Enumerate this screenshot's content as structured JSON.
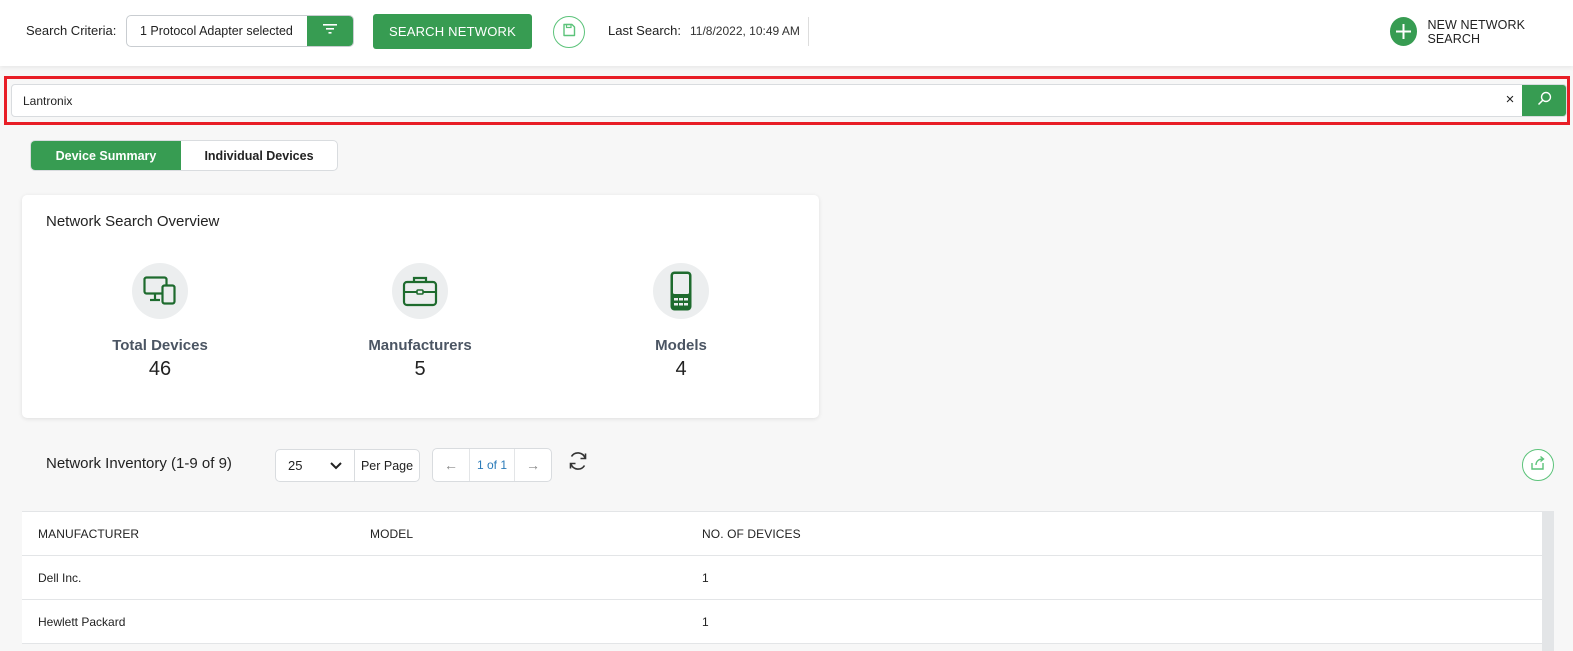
{
  "topbar": {
    "search_criteria_label": "Search Criteria:",
    "criteria_value": "1 Protocol Adapter selected",
    "search_network_label": "SEARCH NETWORK",
    "last_search_label": "Last Search:",
    "last_search_value": "11/8/2022, 10:49 AM",
    "new_search_label": "NEW NETWORK SEARCH"
  },
  "search": {
    "value": "Lantronix",
    "clear_symbol": "×"
  },
  "tabs": [
    {
      "label": "Device Summary",
      "active": true
    },
    {
      "label": "Individual Devices",
      "active": false
    }
  ],
  "overview": {
    "title": "Network Search Overview",
    "stats": [
      {
        "icon": "devices-icon",
        "label": "Total Devices",
        "value": "46"
      },
      {
        "icon": "briefcase-icon",
        "label": "Manufacturers",
        "value": "5"
      },
      {
        "icon": "handheld-device-icon",
        "label": "Models",
        "value": "4"
      }
    ]
  },
  "inventory": {
    "title": "Network Inventory (1-9 of 9)",
    "per_page_value": "25",
    "per_page_label": "Per Page",
    "page_indicator": "1 of 1",
    "prev_symbol": "←",
    "next_symbol": "→",
    "columns": [
      "MANUFACTURER",
      "MODEL",
      "NO. OF DEVICES"
    ],
    "rows": [
      {
        "manufacturer": "Dell Inc.",
        "model": "",
        "devices": "1"
      },
      {
        "manufacturer": "Hewlett Packard",
        "model": "",
        "devices": "1"
      }
    ]
  },
  "colors": {
    "accent": "#379c52",
    "accent_light": "#5cc37a",
    "highlight_outline": "#e81e26",
    "link": "#2b7bb9",
    "icon_green": "#1e6b2e"
  }
}
